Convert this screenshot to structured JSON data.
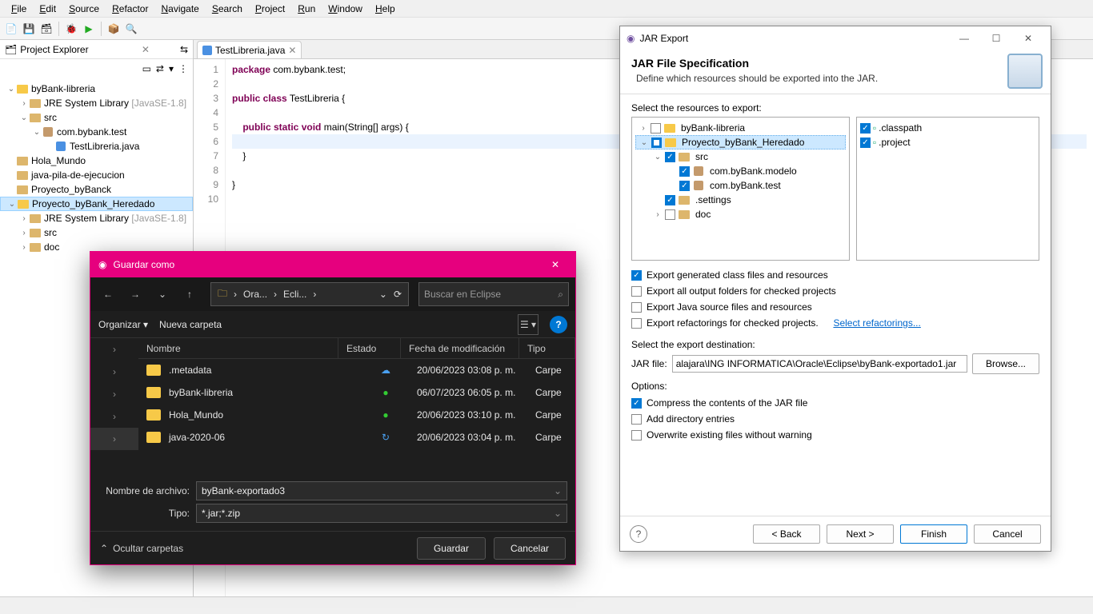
{
  "menubar": [
    "File",
    "Edit",
    "Source",
    "Refactor",
    "Navigate",
    "Search",
    "Project",
    "Run",
    "Window",
    "Help"
  ],
  "project_explorer": {
    "title": "Project Explorer",
    "items": [
      {
        "label": "byBank-libreria",
        "depth": 0,
        "arrow": "v",
        "icon": "proj"
      },
      {
        "label": "JRE System Library",
        "suffix": "[JavaSE-1.8]",
        "depth": 1,
        "arrow": ">",
        "icon": "lib"
      },
      {
        "label": "src",
        "depth": 1,
        "arrow": "v",
        "icon": "src"
      },
      {
        "label": "com.bybank.test",
        "depth": 2,
        "arrow": "v",
        "icon": "pkg"
      },
      {
        "label": "TestLibreria.java",
        "depth": 3,
        "arrow": "",
        "icon": "java"
      },
      {
        "label": "Hola_Mundo",
        "depth": 0,
        "arrow": "",
        "icon": "folder"
      },
      {
        "label": "java-pila-de-ejecucion",
        "depth": 0,
        "arrow": "",
        "icon": "folder"
      },
      {
        "label": "Proyecto_byBanck",
        "depth": 0,
        "arrow": "",
        "icon": "folder"
      },
      {
        "label": "Proyecto_byBank_Heredado",
        "depth": 0,
        "arrow": "v",
        "icon": "proj",
        "selected": true
      },
      {
        "label": "JRE System Library",
        "suffix": "[JavaSE-1.8]",
        "depth": 1,
        "arrow": ">",
        "icon": "lib"
      },
      {
        "label": "src",
        "depth": 1,
        "arrow": ">",
        "icon": "src"
      },
      {
        "label": "doc",
        "depth": 1,
        "arrow": ">",
        "icon": "folder"
      }
    ]
  },
  "editor": {
    "tab": "TestLibreria.java",
    "lines": [
      {
        "n": 1,
        "html": "<span class='kw'>package</span> com.bybank.test;"
      },
      {
        "n": 2,
        "html": ""
      },
      {
        "n": 3,
        "html": "<span class='kw'>public class</span> TestLibreria {"
      },
      {
        "n": 4,
        "html": ""
      },
      {
        "n": 5,
        "html": "    <span class='kw'>public static void</span> main(String[] args) {"
      },
      {
        "n": 6,
        "html": "",
        "cur": true
      },
      {
        "n": 7,
        "html": "    }"
      },
      {
        "n": 8,
        "html": ""
      },
      {
        "n": 9,
        "html": "}"
      },
      {
        "n": 10,
        "html": ""
      }
    ]
  },
  "jar_export": {
    "window_title": "JAR Export",
    "title": "JAR File Specification",
    "subtitle": "Define which resources should be exported into the JAR.",
    "select_label": "Select the resources to export:",
    "tree": [
      {
        "label": "byBank-libreria",
        "depth": 0,
        "arrow": ">",
        "check": "off",
        "icon": "proj"
      },
      {
        "label": "Proyecto_byBank_Heredado",
        "depth": 0,
        "arrow": "v",
        "check": "ind",
        "icon": "proj",
        "sel": true
      },
      {
        "label": "src",
        "depth": 1,
        "arrow": "v",
        "check": "on",
        "icon": "src"
      },
      {
        "label": "com.byBank.modelo",
        "depth": 2,
        "arrow": "",
        "check": "on",
        "icon": "pkg"
      },
      {
        "label": "com.byBank.test",
        "depth": 2,
        "arrow": "",
        "check": "on",
        "icon": "pkg"
      },
      {
        "label": ".settings",
        "depth": 1,
        "arrow": "",
        "check": "on",
        "icon": "folder"
      },
      {
        "label": "doc",
        "depth": 1,
        "arrow": ">",
        "check": "off",
        "icon": "folder"
      }
    ],
    "files": [
      {
        "label": ".classpath",
        "check": "on"
      },
      {
        "label": ".project",
        "check": "on"
      }
    ],
    "checks": [
      {
        "label": "Export generated class files and resources",
        "on": true
      },
      {
        "label": "Export all output folders for checked projects",
        "on": false
      },
      {
        "label": "Export Java source files and resources",
        "on": false
      },
      {
        "label": "Export refactorings for checked projects.",
        "on": false,
        "link": "Select refactorings..."
      }
    ],
    "dest_label": "Select the export destination:",
    "jar_file_label": "JAR file:",
    "jar_file_value": "alajara\\ING INFORMATICA\\Oracle\\Eclipse\\byBank-exportado1.jar",
    "browse": "Browse...",
    "options_label": "Options:",
    "option_checks": [
      {
        "label": "Compress the contents of the JAR file",
        "on": true
      },
      {
        "label": "Add directory entries",
        "on": false
      },
      {
        "label": "Overwrite existing files without warning",
        "on": false
      }
    ],
    "buttons": {
      "back": "< Back",
      "next": "Next >",
      "finish": "Finish",
      "cancel": "Cancel"
    }
  },
  "save_dialog": {
    "title": "Guardar como",
    "crumbs": [
      "Ora...",
      "Ecli..."
    ],
    "search_placeholder": "Buscar en Eclipse",
    "organize": "Organizar",
    "new_folder": "Nueva carpeta",
    "columns": {
      "name": "Nombre",
      "status": "Estado",
      "date": "Fecha de modificación",
      "type": "Tipo"
    },
    "rows": [
      {
        "name": ".metadata",
        "status": "cloud",
        "date": "20/06/2023 03:08 p. m.",
        "type": "Carpe"
      },
      {
        "name": "byBank-libreria",
        "status": "ok",
        "date": "06/07/2023 06:05 p. m.",
        "type": "Carpe"
      },
      {
        "name": "Hola_Mundo",
        "status": "ok",
        "date": "20/06/2023 03:10 p. m.",
        "type": "Carpe"
      },
      {
        "name": "java-2020-06",
        "status": "sync",
        "date": "20/06/2023 03:04 p. m.",
        "type": "Carpe"
      }
    ],
    "filename_label": "Nombre de archivo:",
    "filename_value": "byBank-exportado3",
    "type_label": "Tipo:",
    "type_value": "*.jar;*.zip",
    "hide_folders": "Ocultar carpetas",
    "save": "Guardar",
    "cancel": "Cancelar"
  }
}
